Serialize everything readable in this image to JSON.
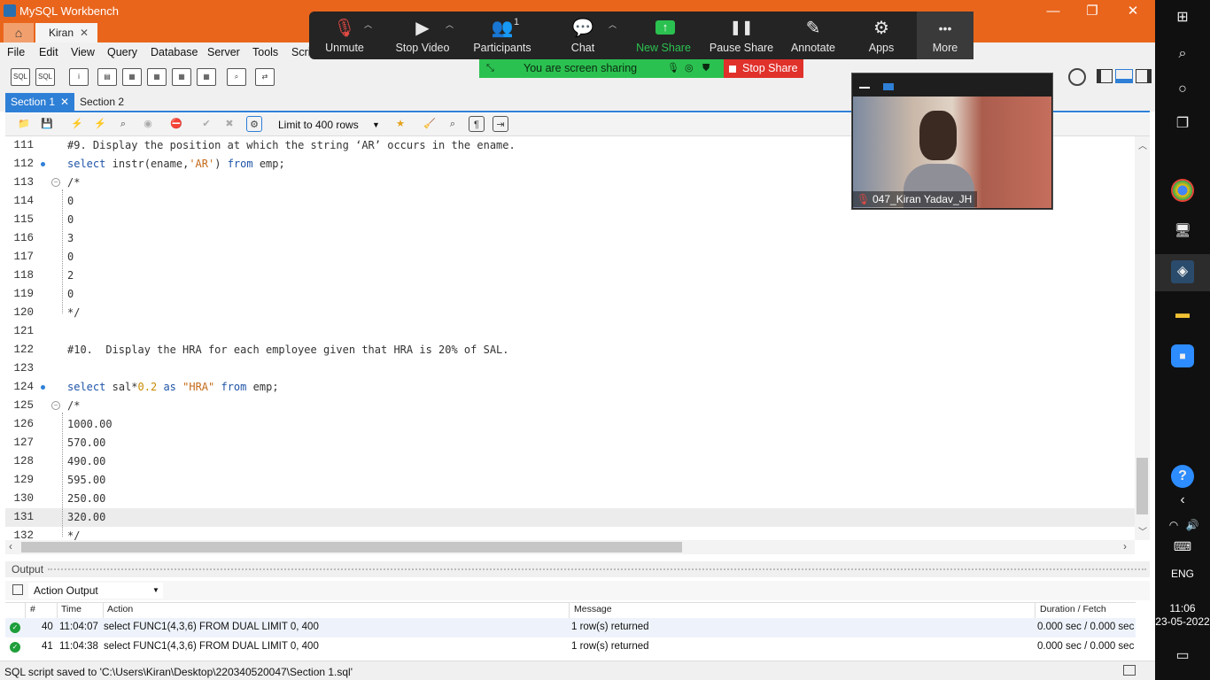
{
  "window": {
    "title": "MySQL Workbench",
    "minimize": "—",
    "maximize": "❐",
    "close": "✕"
  },
  "tabs": {
    "home_icon": "house-icon",
    "connection": "Kiran",
    "close": "✕"
  },
  "menu": [
    "File",
    "Edit",
    "View",
    "Query",
    "Database",
    "Server",
    "Tools",
    "Scripting"
  ],
  "editor_tabs": [
    "Section 1",
    "Section 2"
  ],
  "sql_toolbar": {
    "limit": "Limit to 400 rows"
  },
  "editor": {
    "lines": [
      {
        "n": "111",
        "text": "#9. Display the position at which the string ‘AR’ occurs in the ename."
      },
      {
        "n": "112",
        "text": "select instr(ename,'AR') from emp;"
      },
      {
        "n": "113",
        "text": "/*"
      },
      {
        "n": "114",
        "text": "0"
      },
      {
        "n": "115",
        "text": "0"
      },
      {
        "n": "116",
        "text": "3"
      },
      {
        "n": "117",
        "text": "0"
      },
      {
        "n": "118",
        "text": "2"
      },
      {
        "n": "119",
        "text": "0"
      },
      {
        "n": "120",
        "text": "*/"
      },
      {
        "n": "121",
        "text": ""
      },
      {
        "n": "122",
        "text": "#10.  Display the HRA for each employee given that HRA is 20% of SAL."
      },
      {
        "n": "123",
        "text": ""
      },
      {
        "n": "124",
        "text": "select sal*0.2 as \"HRA\" from emp;"
      },
      {
        "n": "125",
        "text": "/*"
      },
      {
        "n": "126",
        "text": "1000.00"
      },
      {
        "n": "127",
        "text": "570.00"
      },
      {
        "n": "128",
        "text": "490.00"
      },
      {
        "n": "129",
        "text": "595.00"
      },
      {
        "n": "130",
        "text": "250.00"
      },
      {
        "n": "131",
        "text": "320.00"
      },
      {
        "n": "132",
        "text": "*/"
      }
    ]
  },
  "output": {
    "title": "Output",
    "mode": "Action Output",
    "columns": [
      "#",
      "Time",
      "Action",
      "Message",
      "Duration / Fetch"
    ],
    "rows": [
      {
        "n": "40",
        "time": "11:04:07",
        "action": "select FUNC1(4,3,6) FROM DUAL LIMIT 0, 400",
        "message": "1 row(s) returned",
        "duration": "0.000 sec / 0.000 sec"
      },
      {
        "n": "41",
        "time": "11:04:38",
        "action": "select FUNC1(4,3,6) FROM DUAL LIMIT 0, 400",
        "message": "1 row(s) returned",
        "duration": "0.000 sec / 0.000 sec"
      }
    ]
  },
  "status": "SQL script saved to 'C:\\Users\\Kiran\\Desktop\\220340520047\\Section 1.sql'",
  "zoom": {
    "buttons": [
      {
        "label": "Unmute",
        "icon": "🎙"
      },
      {
        "label": "Stop Video",
        "icon": "▶"
      },
      {
        "label": "Participants",
        "icon": "👥"
      },
      {
        "label": "Chat",
        "icon": "💬"
      },
      {
        "label": "New Share",
        "icon": "↑"
      },
      {
        "label": "Pause Share",
        "icon": "❚❚"
      },
      {
        "label": "Annotate",
        "icon": "✎"
      },
      {
        "label": "Apps",
        "icon": "⚙"
      },
      {
        "label": "More",
        "icon": "•••"
      }
    ],
    "participants_count": "1",
    "sharing_text": "You are screen sharing",
    "stop_share": "Stop Share",
    "video_name": "047_Kiran Yadav_JH"
  },
  "taskbar": {
    "lang": "ENG",
    "time": "11:06",
    "date": "23-05-2022"
  }
}
